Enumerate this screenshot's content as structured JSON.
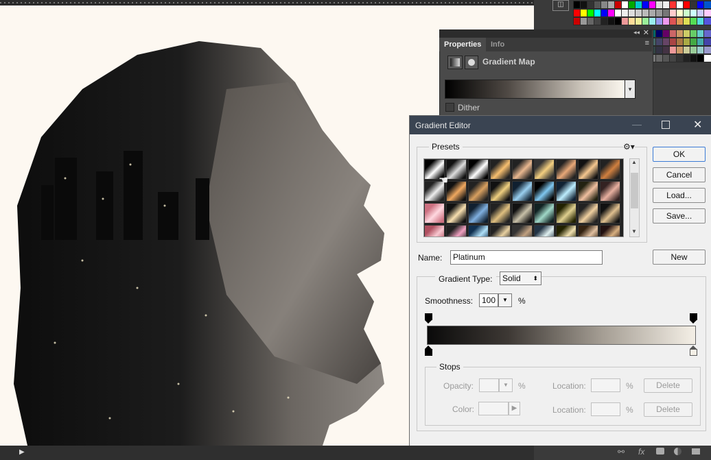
{
  "properties_panel": {
    "tabs": [
      {
        "label": "Properties"
      },
      {
        "label": "Info"
      }
    ],
    "adjustment_title": "Gradient Map",
    "dither_label": "Dither"
  },
  "gradient_editor": {
    "title": "Gradient Editor",
    "presets_label": "Presets",
    "buttons": {
      "ok": "OK",
      "cancel": "Cancel",
      "load": "Load...",
      "save": "Save...",
      "new": "New"
    },
    "name_label": "Name:",
    "name_value": "Platinum",
    "gradient_type_label": "Gradient Type:",
    "gradient_type_value": "Solid",
    "smoothness_label": "Smoothness:",
    "smoothness_value": "100",
    "percent_sign": "%",
    "stops_label": "Stops",
    "opacity_label": "Opacity:",
    "color_label": "Color:",
    "location_label": "Location:",
    "delete_label": "Delete"
  },
  "colors": {
    "dialog_title_bg": "#3a4452",
    "panel_bg": "#4a4a4a",
    "canvas_bg": "#fdf8f1"
  }
}
